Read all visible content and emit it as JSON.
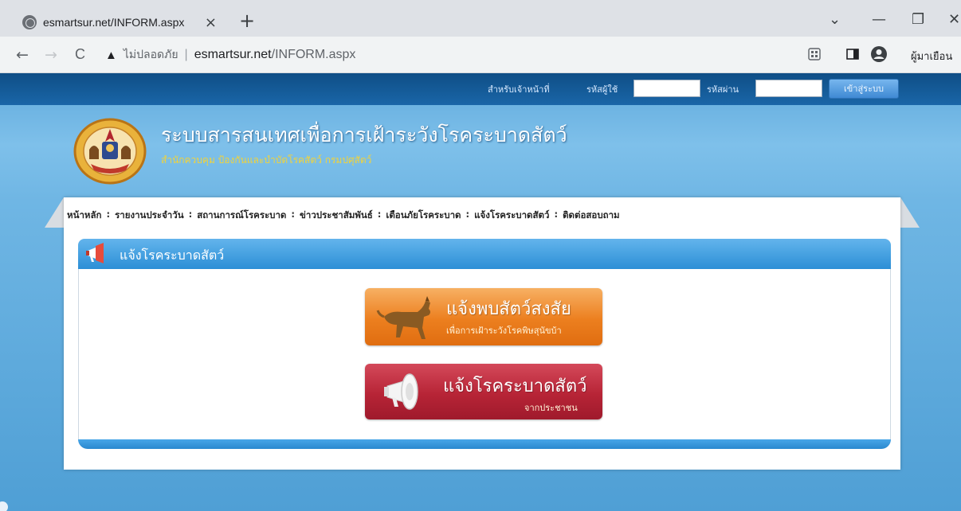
{
  "browser": {
    "tab_title": "esmartsur.net/INFORM.aspx",
    "tab_close": "×",
    "new_tab": "+",
    "window_controls": {
      "dropdown": "⌄",
      "minimize": "—",
      "restore": "❐",
      "close": "✕"
    },
    "nav": {
      "back": "←",
      "forward": "→",
      "reload": "C"
    },
    "security_label": "ไม่ปลอดภัย",
    "separator": "|",
    "url_host": "esmartsur.net",
    "url_path": "/INFORM.aspx",
    "profile_label": "ผู้มาเยือน"
  },
  "login": {
    "staff_label": "สำหรับเจ้าหน้าที่",
    "user_label": "รหัสผู้ใช้",
    "password_label": "รหัสผ่าน",
    "submit_label": "เข้าสู่ระบบ",
    "user_value": "",
    "password_value": ""
  },
  "header": {
    "title": "ระบบสารสนเทศเพื่อการเฝ้าระวังโรคระบาดสัตว์",
    "subtitle": "สำนักควบคุม ป้องกันและบำบัดโรคสัตว์ กรมปศุสัตว์"
  },
  "menu": {
    "items": [
      "หน้าหลัก",
      "รายงานประจำวัน",
      "สถานการณ์โรคระบาด",
      "ข่าวประชาสัมพันธ์",
      "เตือนภัยโรคระบาด",
      "แจ้งโรคระบาดสัตว์",
      "ติดต่อสอบถาม"
    ],
    "separator": ":"
  },
  "panel": {
    "title": "แจ้งโรคระบาดสัตว์"
  },
  "buttons": {
    "suspect_animal": {
      "title": "แจ้งพบสัตว์สงสัย",
      "subtitle": "เพื่อการเฝ้าระวังโรคพิษสุนัขบ้า"
    },
    "public_report": {
      "title": "แจ้งโรคระบาดสัตว์",
      "subtitle": "จากประชาชน"
    }
  },
  "colors": {
    "top_strip": "#1a66a8",
    "page_bg": "#6fb6e4",
    "panel_bar": "#2c8fd6",
    "subtitle_yellow": "#f2d33a",
    "orange_button": "#ec7f1f",
    "red_button": "#b72436"
  },
  "icons": {
    "tab": "globe-icon",
    "warning": "warning-icon",
    "extension": "qr-icon",
    "sidepanel": "sidepanel-icon",
    "profile": "profile-icon",
    "panel": "megaphone-icon",
    "suspect_button": "dog-icon",
    "report_button": "megaphone-icon"
  }
}
